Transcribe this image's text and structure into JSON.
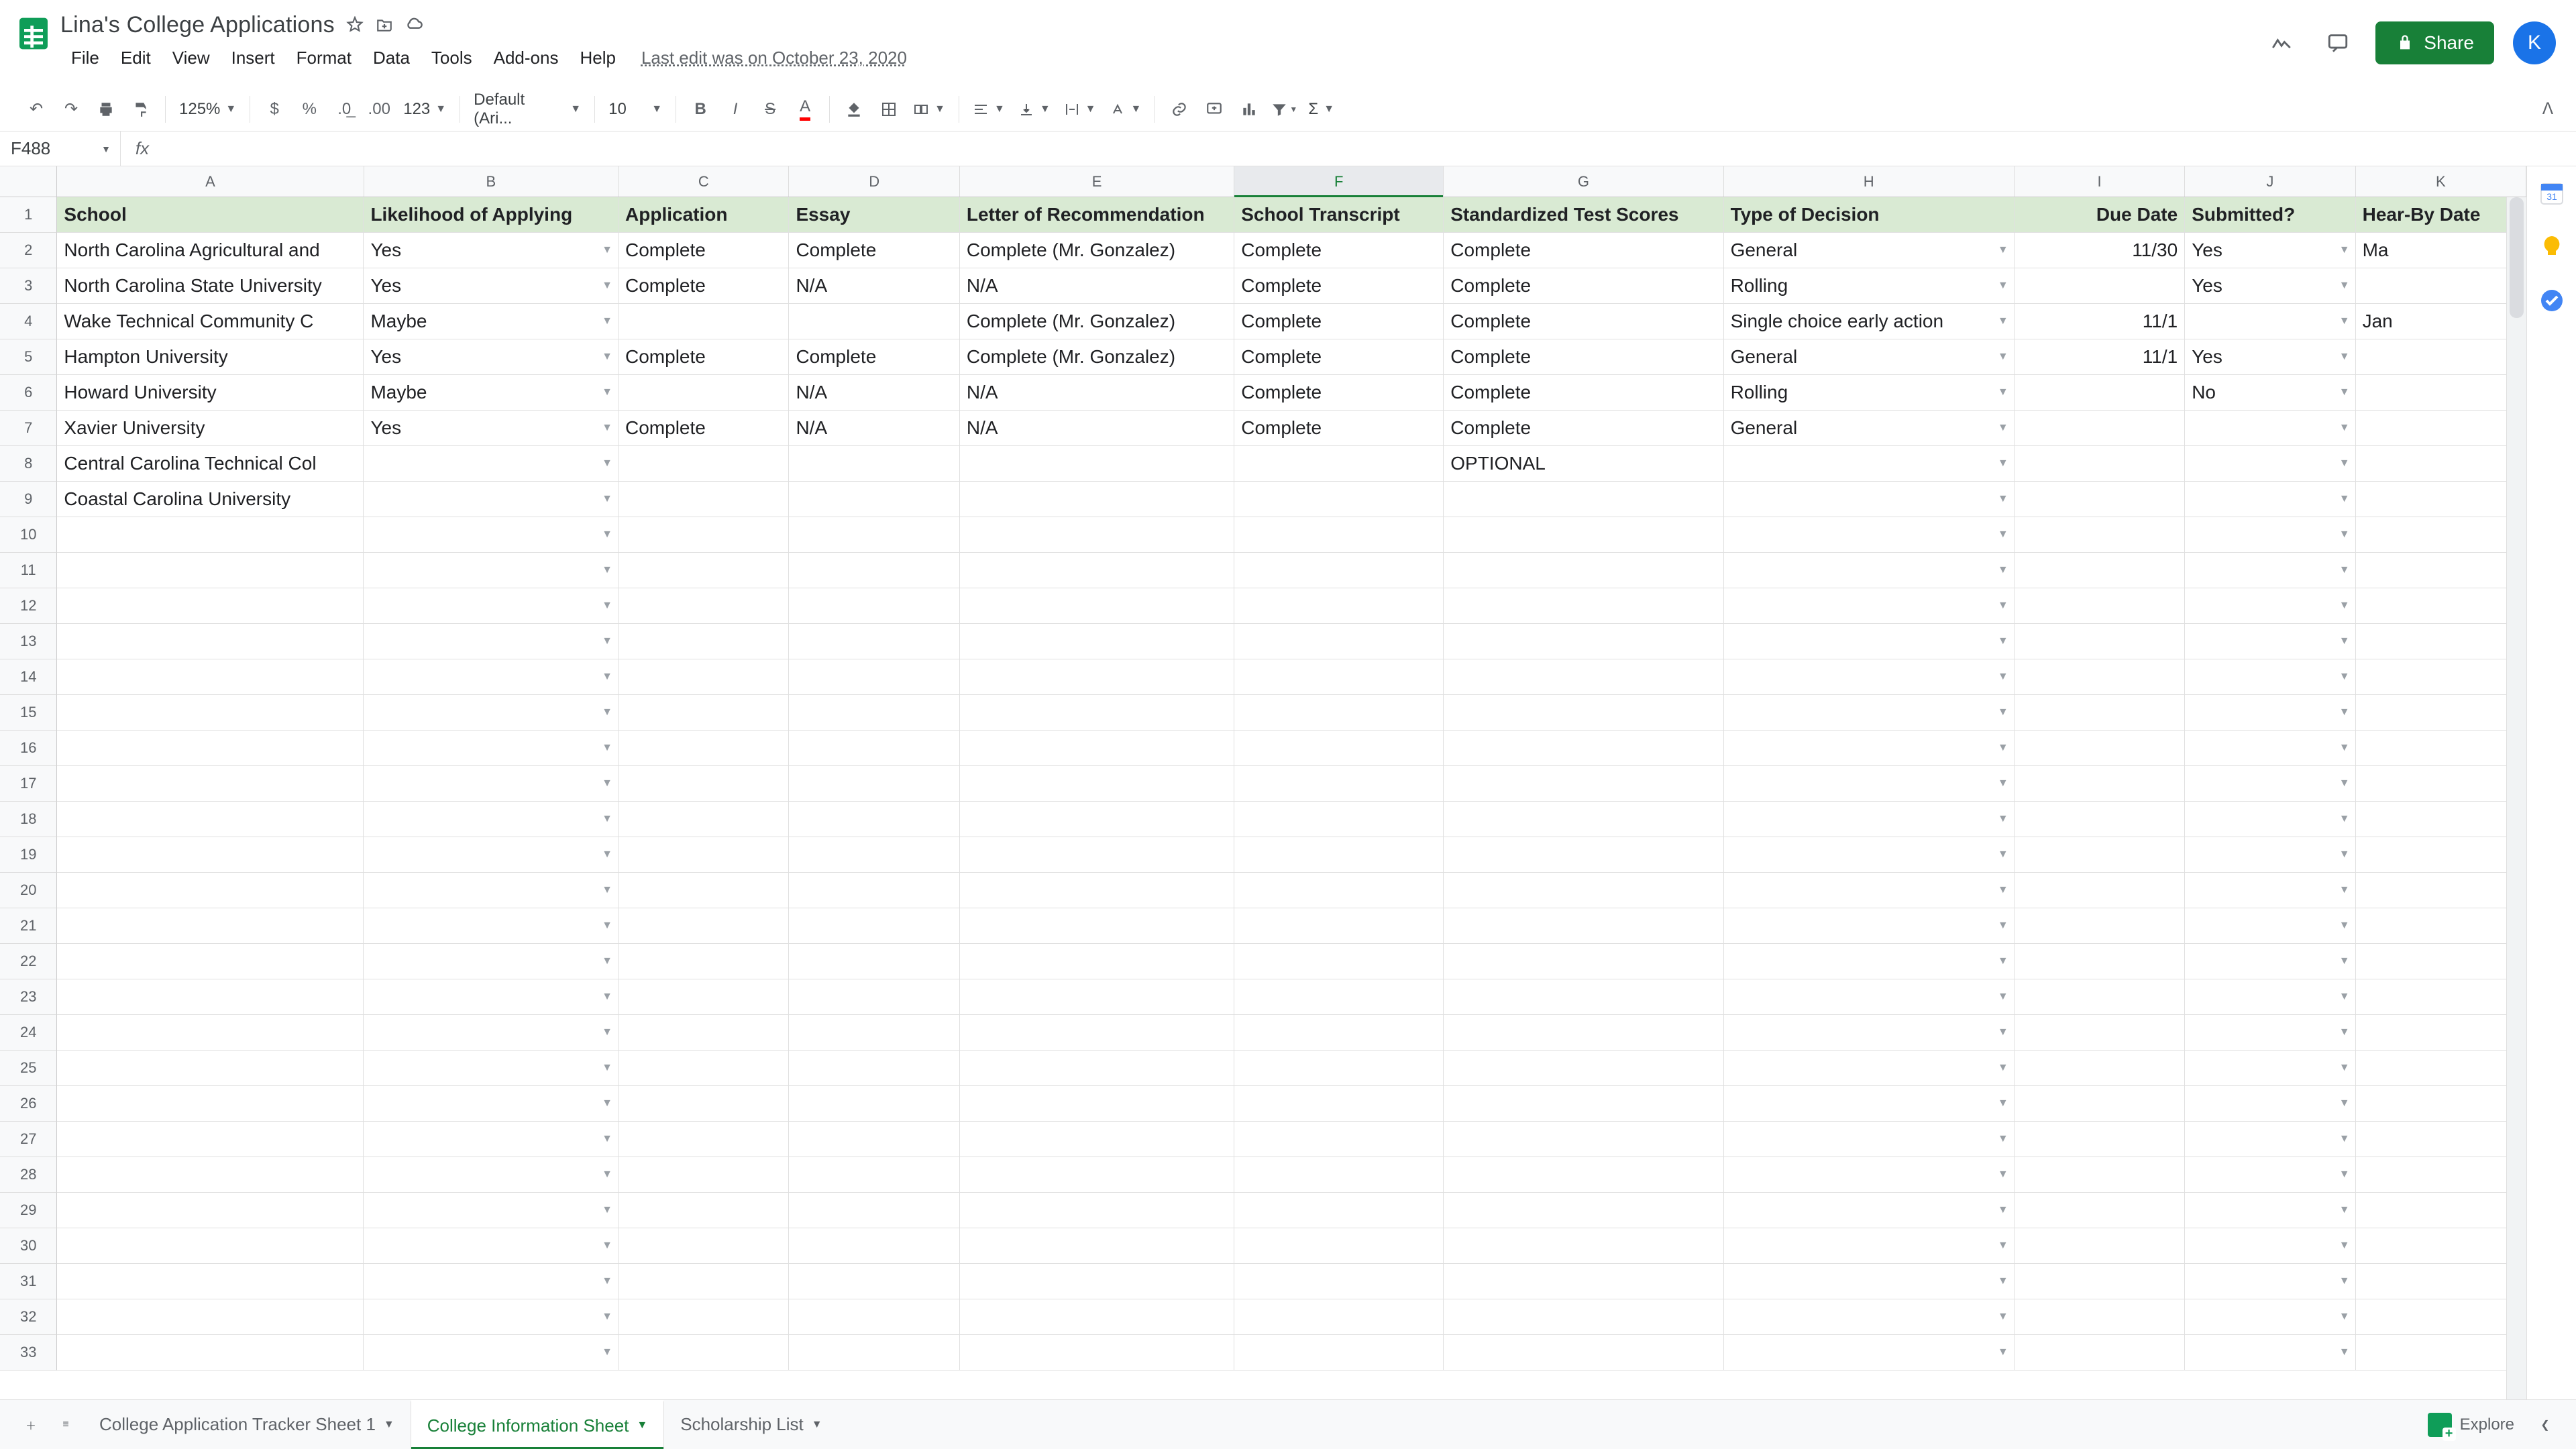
{
  "doc": {
    "title": "Lina's College Applications"
  },
  "menu": {
    "file": "File",
    "edit": "Edit",
    "view": "View",
    "insert": "Insert",
    "format": "Format",
    "data": "Data",
    "tools": "Tools",
    "addons": "Add-ons",
    "help": "Help",
    "last_edit": "Last edit was on October 23, 2020"
  },
  "header": {
    "share": "Share",
    "avatar_initial": "K"
  },
  "toolbar": {
    "zoom": "125%",
    "font": "Default (Ari...",
    "size": "10",
    "more": "123"
  },
  "fx": {
    "name_box": "F488"
  },
  "columns": {
    "A": "A",
    "B": "B",
    "C": "C",
    "D": "D",
    "E": "E",
    "F": "F",
    "G": "G",
    "H": "H",
    "I": "I",
    "J": "J",
    "K": "K"
  },
  "headers": {
    "A": "School",
    "B": "Likelihood of Applying",
    "C": "Application",
    "D": "Essay",
    "E": "Letter of Recommendation",
    "F": "School Transcript",
    "G": "Standardized Test Scores",
    "H": "Type of Decision",
    "I": "Due Date",
    "J": "Submitted?",
    "K": "Hear-By Date"
  },
  "rows": [
    {
      "A": "North Carolina Agricultural and",
      "B": "Yes",
      "C": "Complete",
      "D": "Complete",
      "E": "Complete (Mr. Gonzalez)",
      "F": "Complete",
      "G": "Complete",
      "H": "General",
      "I": "11/30",
      "J": "Yes",
      "K": "Ma"
    },
    {
      "A": "North Carolina State University",
      "B": "Yes",
      "C": "Complete",
      "D": "N/A",
      "E": "N/A",
      "F": "Complete",
      "G": "Complete",
      "H": "Rolling",
      "I": "",
      "J": "Yes",
      "K": ""
    },
    {
      "A": "Wake Technical Community C",
      "B": "Maybe",
      "C": "",
      "D": "",
      "E": "Complete (Mr. Gonzalez)",
      "F": "Complete",
      "G": "Complete",
      "H": "Single choice early action",
      "I": "11/1",
      "J": "",
      "K": "Jan"
    },
    {
      "A": "Hampton University",
      "B": "Yes",
      "C": "Complete",
      "D": "Complete",
      "E": "Complete (Mr. Gonzalez)",
      "F": "Complete",
      "G": "Complete",
      "H": "General",
      "I": "11/1",
      "J": "Yes",
      "K": ""
    },
    {
      "A": "Howard University",
      "B": "Maybe",
      "C": "",
      "D": "N/A",
      "E": "N/A",
      "F": "Complete",
      "G": "Complete",
      "H": "Rolling",
      "I": "",
      "J": "No",
      "K": ""
    },
    {
      "A": "Xavier University",
      "B": "Yes",
      "C": "Complete",
      "D": "N/A",
      "E": "N/A",
      "F": "Complete",
      "G": "Complete",
      "H": "General",
      "I": "",
      "J": "",
      "K": ""
    },
    {
      "A": "Central Carolina Technical Col",
      "B": "",
      "C": "",
      "D": "",
      "E": "",
      "F": "",
      "G": "OPTIONAL",
      "H": "",
      "I": "",
      "J": "",
      "K": ""
    },
    {
      "A": "Coastal Carolina University",
      "B": "",
      "C": "",
      "D": "",
      "E": "",
      "F": "",
      "G": "",
      "H": "",
      "I": "",
      "J": "",
      "K": ""
    }
  ],
  "blank_rows_from": 10,
  "blank_rows_to": 33,
  "tabs": {
    "t1": "College Application Tracker Sheet 1",
    "t2": "College Information Sheet",
    "t3": "Scholarship List"
  },
  "explore": "Explore"
}
